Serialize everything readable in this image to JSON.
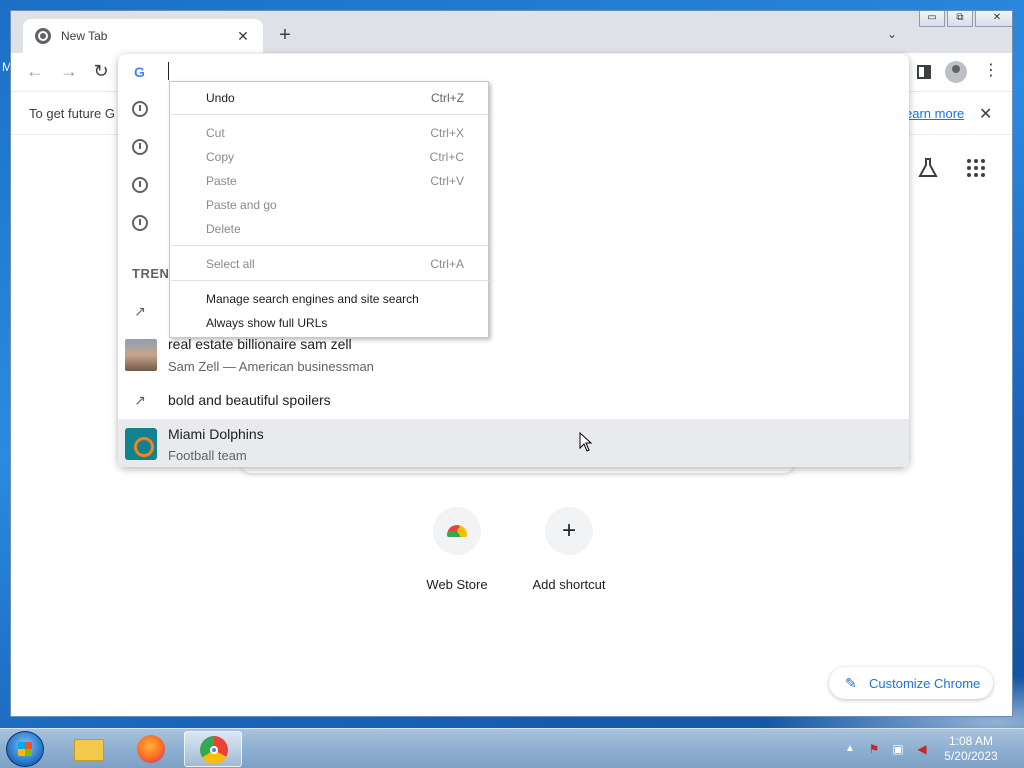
{
  "tab": {
    "title": "New Tab",
    "close": "✕"
  },
  "new_tab_plus": "+",
  "tab_search": "⌄",
  "window_controls": {
    "minimize": "▭",
    "restore": "⧉",
    "close": "✕"
  },
  "nav": {
    "back": "←",
    "forward": "→",
    "reload": "↻"
  },
  "omnibox": {
    "google_letter": "G",
    "trending_header": "TREN",
    "suggestions": [
      {
        "title": "real estate billionaire sam zell",
        "subtitle": "Sam Zell — American businessman"
      },
      {
        "title": "bold and beautiful spoilers",
        "subtitle": ""
      },
      {
        "title": "Miami Dolphins",
        "subtitle": "Football team"
      }
    ]
  },
  "infobar": {
    "message": "To get future G",
    "learn_more": "earn more",
    "close": "✕"
  },
  "context_menu": {
    "items": [
      {
        "label": "Undo",
        "shortcut": "Ctrl+Z",
        "enabled": true
      },
      {
        "label": "Cut",
        "shortcut": "Ctrl+X",
        "enabled": false
      },
      {
        "label": "Copy",
        "shortcut": "Ctrl+C",
        "enabled": false
      },
      {
        "label": "Paste",
        "shortcut": "Ctrl+V",
        "enabled": false
      },
      {
        "label": "Paste and go",
        "shortcut": "",
        "enabled": false
      },
      {
        "label": "Delete",
        "shortcut": "",
        "enabled": false
      },
      {
        "label": "Select all",
        "shortcut": "Ctrl+A",
        "enabled": false
      },
      {
        "label": "Manage search engines and site search",
        "shortcut": "",
        "enabled": true
      },
      {
        "label": "Always show full URLs",
        "shortcut": "",
        "enabled": true
      }
    ]
  },
  "shortcuts": [
    {
      "label": "Web Store",
      "icon": "webstore-icon"
    },
    {
      "label": "Add shortcut",
      "icon": "plus-icon"
    }
  ],
  "customize": {
    "label": "Customize Chrome",
    "icon": "✎"
  },
  "taskbar": {
    "apps": [
      "explorer",
      "firefox",
      "chrome"
    ],
    "active": "chrome"
  },
  "tray": {
    "time": "1:08 AM",
    "date": "5/20/2023"
  },
  "desktop_label": "M"
}
